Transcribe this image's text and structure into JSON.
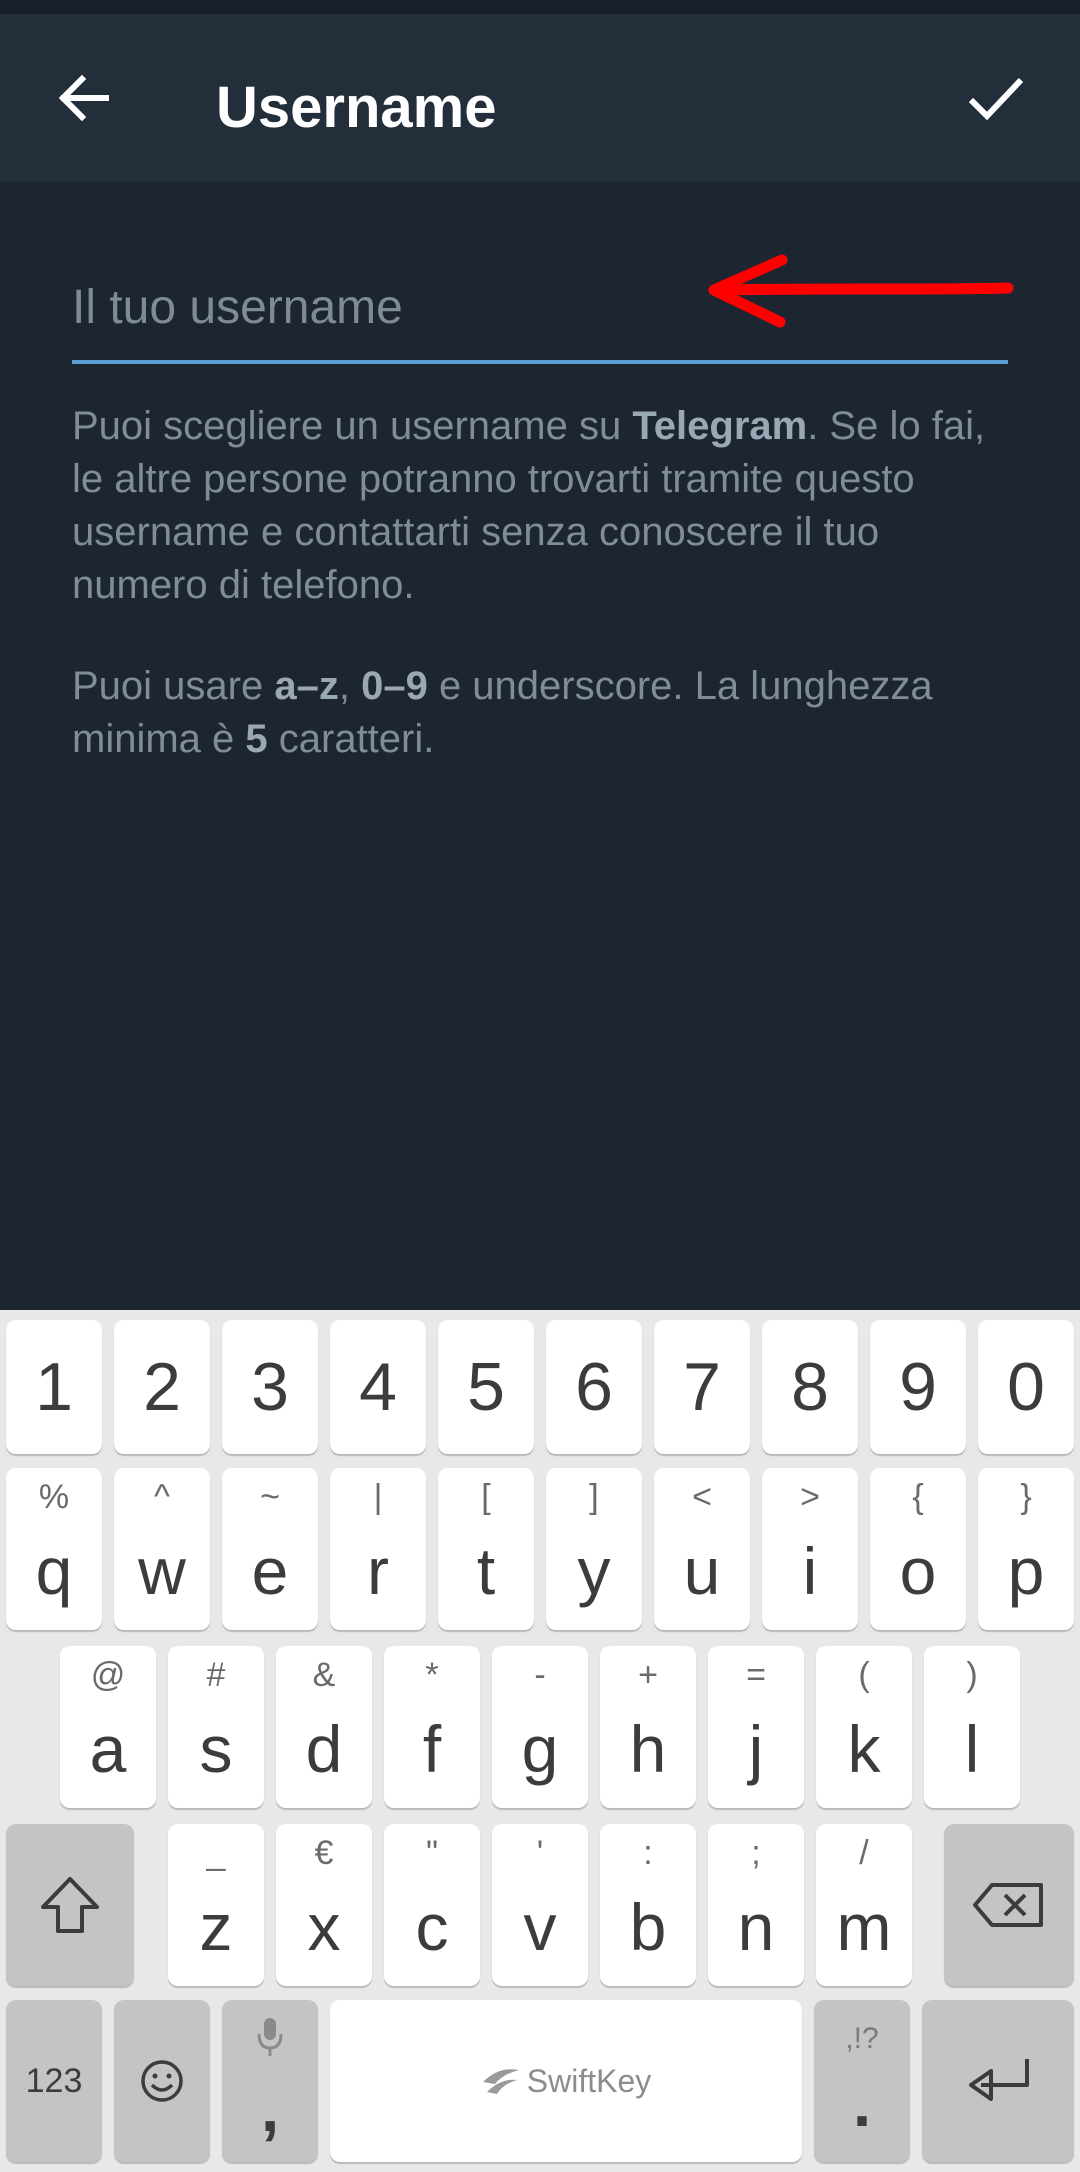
{
  "appbar": {
    "title": "Username"
  },
  "input": {
    "placeholder": "Il tuo username",
    "value": ""
  },
  "help": {
    "p1_a": "Puoi scegliere un username su ",
    "p1_b": "Telegram",
    "p1_c": ". Se lo fai, le altre persone potranno trovarti tramite questo username e contattarti senza conoscere il tuo numero di telefono.",
    "p2_a": "Puoi usare ",
    "p2_b": "a–z",
    "p2_c": ", ",
    "p2_d": "0–9",
    "p2_e": " e underscore. La lunghezza minima è ",
    "p2_f": "5",
    "p2_g": " caratteri."
  },
  "keyboard": {
    "numbers": [
      "1",
      "2",
      "3",
      "4",
      "5",
      "6",
      "7",
      "8",
      "9",
      "0"
    ],
    "row1": [
      [
        "q",
        "%"
      ],
      [
        "w",
        "^"
      ],
      [
        "e",
        "~"
      ],
      [
        "r",
        "|"
      ],
      [
        "t",
        "["
      ],
      [
        "y",
        "]"
      ],
      [
        "u",
        "<"
      ],
      [
        "i",
        ">"
      ],
      [
        "o",
        "{"
      ],
      [
        "p",
        "}"
      ]
    ],
    "row2": [
      [
        "a",
        "@"
      ],
      [
        "s",
        "#"
      ],
      [
        "d",
        "&"
      ],
      [
        "f",
        "*"
      ],
      [
        "g",
        "-"
      ],
      [
        "h",
        "+"
      ],
      [
        "j",
        "="
      ],
      [
        "k",
        "("
      ],
      [
        "l",
        ")"
      ]
    ],
    "row3": [
      [
        "z",
        "_"
      ],
      [
        "x",
        "€"
      ],
      [
        "c",
        "\""
      ],
      [
        "v",
        "'"
      ],
      [
        "b",
        ":"
      ],
      [
        "n",
        ";"
      ],
      [
        "m",
        "/"
      ]
    ],
    "numbers_key": "123",
    "comma": ",",
    "space_brand": "SwiftKey",
    "period": ".",
    "period_alt": ",!?"
  },
  "colors": {
    "appbar": "#222e3a",
    "background": "#1c2530",
    "accent": "#5a9fd4",
    "annotation": "#ff0000"
  }
}
